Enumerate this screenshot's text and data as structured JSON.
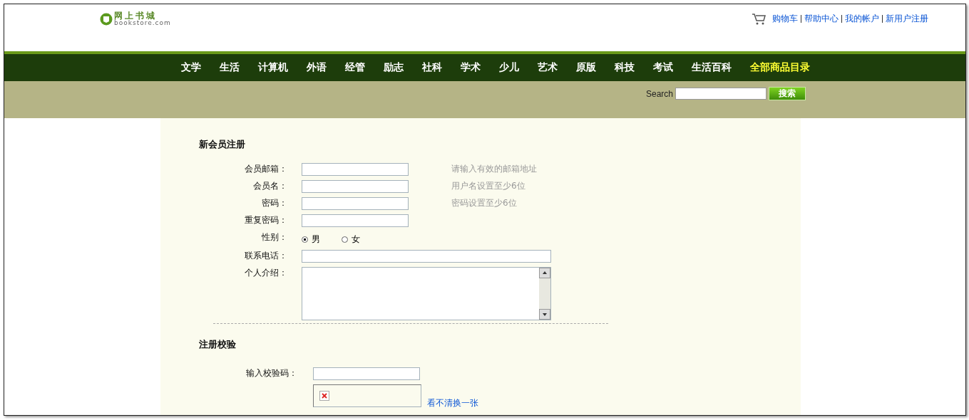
{
  "header": {
    "logo_title": "网上书城",
    "logo_subtitle": "bookstore.com",
    "links": [
      "购物车",
      "帮助中心",
      "我的帐户",
      "新用户注册"
    ]
  },
  "nav": [
    {
      "label": "文学",
      "highlighted": false
    },
    {
      "label": "生活",
      "highlighted": false
    },
    {
      "label": "计算机",
      "highlighted": false
    },
    {
      "label": "外语",
      "highlighted": false
    },
    {
      "label": "经管",
      "highlighted": false
    },
    {
      "label": "励志",
      "highlighted": false
    },
    {
      "label": "社科",
      "highlighted": false
    },
    {
      "label": "学术",
      "highlighted": false
    },
    {
      "label": "少儿",
      "highlighted": false
    },
    {
      "label": "艺术",
      "highlighted": false
    },
    {
      "label": "原版",
      "highlighted": false
    },
    {
      "label": "科技",
      "highlighted": false
    },
    {
      "label": "考试",
      "highlighted": false
    },
    {
      "label": "生活百科",
      "highlighted": false
    },
    {
      "label": "全部商品目录",
      "highlighted": true
    }
  ],
  "search": {
    "label": "Search",
    "button": "搜索"
  },
  "register": {
    "title": "新会员注册",
    "fields": [
      {
        "kind": "text",
        "label": "会员邮箱：",
        "hint": "请输入有效的邮箱地址"
      },
      {
        "kind": "text",
        "label": "会员名：",
        "hint": "用户名设置至少6位"
      },
      {
        "kind": "text",
        "label": "密码：",
        "hint": "密码设置至少6位"
      },
      {
        "kind": "text",
        "label": "重复密码："
      },
      {
        "kind": "radio",
        "label": "性别：",
        "options": [
          {
            "label": "男",
            "selected": true
          },
          {
            "label": "女",
            "selected": false
          }
        ]
      },
      {
        "kind": "wide",
        "label": "联系电话："
      },
      {
        "kind": "textarea",
        "label": "个人介绍："
      }
    ]
  },
  "verify": {
    "title": "注册校验",
    "label": "输入校验码：",
    "refresh_link": "看不清换一张"
  }
}
